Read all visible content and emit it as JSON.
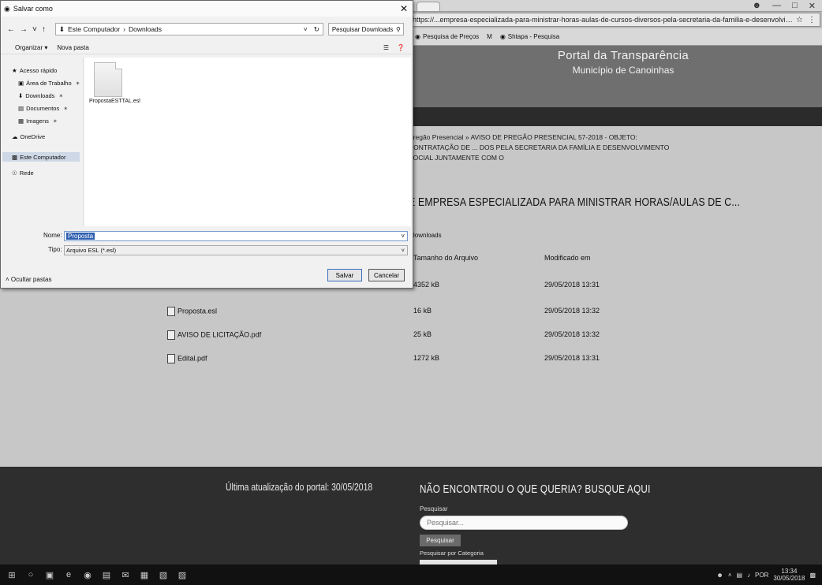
{
  "browser": {
    "address_url": "https://...empresa-especializada-para-ministrar-horas-aulas-de-cursos-diversos-pela-secretaria-da-familia-e-desenvolvimento-social-juntamente-com-o-",
    "bookmarks": [
      {
        "label": "Pesquisa de Preços",
        "icon": "bookmark-icon"
      },
      {
        "label": "M",
        "icon": "gmail-icon"
      },
      {
        "label": "Shtapa - Pesquisa",
        "icon": "bookmark-icon"
      }
    ]
  },
  "site": {
    "title": "Portal da Transparência",
    "subtitle": "Município de Canoinhas",
    "breadcrumb": "Pregão Presencial » AVISO DE PREGÃO PRESENCIAL 57-2018 - OBJETO: CONTRATAÇÃO DE ... DOS PELA SECRETARIA DA FAMÍLIA E DESENVOLVIMENTO SOCIAL JUNTAMENTE COM O",
    "heading": "E EMPRESA ESPECIALIZADA PARA MINISTRAR HORAS/AULAS DE C...",
    "downloads_label": "Downloads",
    "table": {
      "headers": {
        "size": "Tamanho do Arquivo",
        "modified": "Modificado em"
      },
      "rows": [
        {
          "name": "",
          "size": "4352 kB",
          "modified": "29/05/2018 13:31"
        },
        {
          "name": "Proposta.esl",
          "size": "16 kB",
          "modified": "29/05/2018 13:32"
        },
        {
          "name": "AVISO DE LICITAÇÃO.pdf",
          "size": "25 kB",
          "modified": "29/05/2018 13:32"
        },
        {
          "name": "Edital.pdf",
          "size": "1272 kB",
          "modified": "29/05/2018 13:31"
        }
      ]
    }
  },
  "footer": {
    "last_update": "Última atualização do portal: 30/05/2018",
    "search_heading": "NÃO ENCONTROU O QUE QUERIA? BUSQUE AQUI",
    "search_label": "Pesquisar",
    "search_placeholder": "Pesquisar...",
    "search_button": "Pesquisar",
    "category_label": "Pesquisar por Categoria"
  },
  "dialog": {
    "title": "Salvar como",
    "path": [
      "Este Computador",
      "Downloads"
    ],
    "search_placeholder": "Pesquisar Downloads",
    "toolbar": {
      "organize": "Organizar ▾",
      "new_folder": "Nova pasta"
    },
    "sidebar": [
      {
        "label": "Acesso rápido",
        "icon": "star-icon",
        "level": 0,
        "pinned": false
      },
      {
        "label": "Área de Trabalho",
        "icon": "desktop-icon",
        "level": 1,
        "pinned": true
      },
      {
        "label": "Downloads",
        "icon": "download-icon",
        "level": 1,
        "pinned": true
      },
      {
        "label": "Documentos",
        "icon": "document-icon",
        "level": 1,
        "pinned": true
      },
      {
        "label": "Imagens",
        "icon": "image-icon",
        "level": 1,
        "pinned": true
      },
      {
        "label": "OneDrive",
        "icon": "cloud-icon",
        "level": 0,
        "pinned": false
      },
      {
        "label": "Este Computador",
        "icon": "computer-icon",
        "level": 0,
        "pinned": false,
        "selected": true
      },
      {
        "label": "Rede",
        "icon": "network-icon",
        "level": 0,
        "pinned": false
      }
    ],
    "file": {
      "name": "PropostaESTTAL.esl"
    },
    "filename_label": "Nome:",
    "filename_value": "Proposta",
    "type_label": "Tipo:",
    "type_value": "Arquivo ESL (*.esl)",
    "hide_folders": "Ocultar pastas",
    "save_button": "Salvar",
    "cancel_button": "Cancelar"
  },
  "taskbar": {
    "time": "13:34",
    "date": "30/05/2018",
    "language": "POR"
  }
}
